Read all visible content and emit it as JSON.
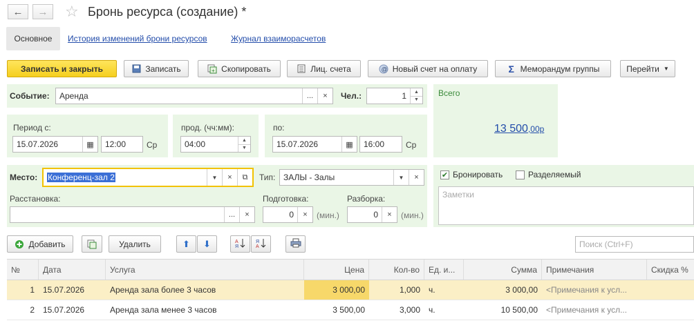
{
  "window": {
    "title": "Бронь ресурса (создание) *"
  },
  "tabs": [
    {
      "label": "Основное"
    },
    {
      "label": "История изменений брони ресурсов"
    },
    {
      "label": "Журнал взаиморасчетов"
    }
  ],
  "toolbar": {
    "save_close": "Записать и закрыть",
    "save": "Записать",
    "copy": "Скопировать",
    "accounts": "Лиц. счета",
    "new_invoice": "Новый счет на оплату",
    "group_memo": "Меморандум группы",
    "goto": "Перейти"
  },
  "form": {
    "event_label": "Событие:",
    "event_value": "Аренда",
    "persons_label": "Чел.:",
    "persons_value": "1",
    "period_from_label": "Период с:",
    "period_from_date": "15.07.2026",
    "period_from_time": "12:00",
    "period_from_day": "Ср",
    "duration_label": "прод. (чч:мм):",
    "duration_value": "04:00",
    "period_to_label": "по:",
    "period_to_date": "15.07.2026",
    "period_to_time": "16:00",
    "period_to_day": "Ср",
    "total_label": "Всего",
    "total_main": "13 500",
    "total_cents": ",00р",
    "place_label": "Место:",
    "place_value": "Конференц-зал 2",
    "type_label": "Тип:",
    "type_value": "ЗАЛЫ - Залы",
    "arrangement_label": "Расстановка:",
    "arrangement_value": "",
    "prep_label": "Подготовка:",
    "prep_value": "0",
    "prep_unit": "(мин.)",
    "teardown_label": "Разборка:",
    "teardown_value": "0",
    "teardown_unit": "(мин.)",
    "book_label": "Бронировать",
    "book_checked": true,
    "shared_label": "Разделяемый",
    "shared_checked": false,
    "notes_placeholder": "Заметки"
  },
  "table_toolbar": {
    "add": "Добавить",
    "delete": "Удалить",
    "search_placeholder": "Поиск (Ctrl+F)"
  },
  "table": {
    "columns": [
      "№",
      "Дата",
      "Услуга",
      "Цена",
      "Кол-во",
      "Ед. и...",
      "Сумма",
      "Примечания",
      "Скидка %"
    ],
    "rows": [
      {
        "n": "1",
        "date": "15.07.2026",
        "service": "Аренда зала более 3 часов",
        "price": "3 000,00",
        "qty": "1,000",
        "unit": "ч.",
        "sum": "3 000,00",
        "note": "<Примечания к усл...",
        "discount": ""
      },
      {
        "n": "2",
        "date": "15.07.2026",
        "service": "Аренда зала менее 3 часов",
        "price": "3 500,00",
        "qty": "3,000",
        "unit": "ч.",
        "sum": "10 500,00",
        "note": "<Примечания к усл...",
        "discount": ""
      }
    ]
  },
  "icons": [
    "arrow-left-icon",
    "arrow-right-icon",
    "star-icon",
    "save-icon",
    "copy-icon",
    "accounts-icon",
    "invoice-icon",
    "sigma-icon",
    "dropdown-icon",
    "calendar-icon",
    "add-icon",
    "copy-row-icon",
    "move-up-icon",
    "move-down-icon",
    "sort-asc-icon",
    "sort-desc-icon",
    "print-icon"
  ],
  "colors": {
    "accent_yellow": "#f5cf1f",
    "panel_green": "#eaf6e6",
    "link_blue": "#224caa",
    "selected_row": "#fbefc6"
  }
}
